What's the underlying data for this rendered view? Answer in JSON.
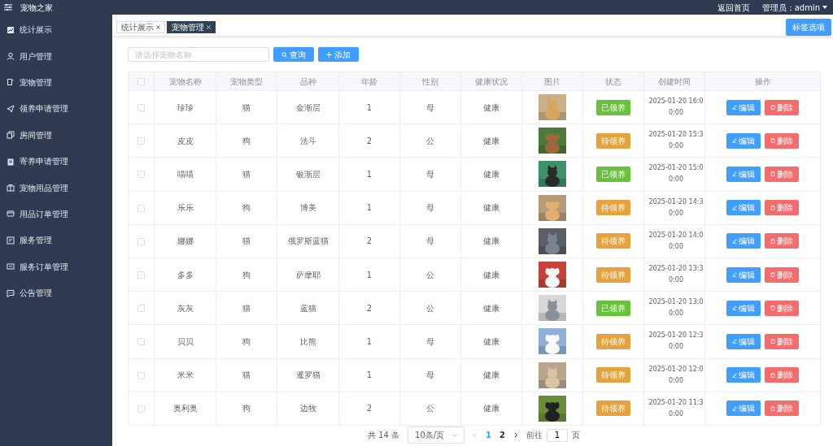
{
  "app": {
    "title": "宠物之家",
    "home_link": "返回首页",
    "user": "管理员：admin"
  },
  "sidebar": {
    "items": [
      {
        "label": "统计展示"
      },
      {
        "label": "用户管理"
      },
      {
        "label": "宠物管理"
      },
      {
        "label": "领养申请管理"
      },
      {
        "label": "房间管理"
      },
      {
        "label": "寄养申请管理"
      },
      {
        "label": "宠物用品管理"
      },
      {
        "label": "用品订单管理"
      },
      {
        "label": "服务管理"
      },
      {
        "label": "服务订单管理"
      },
      {
        "label": "公告管理"
      }
    ]
  },
  "tabs": [
    {
      "label": "统计展示",
      "selected": false
    },
    {
      "label": "宠物管理",
      "selected": true
    }
  ],
  "tab_options": "标签选项",
  "search": {
    "placeholder": "请选择宠物名称",
    "query_button": "查询",
    "add_button": "添加"
  },
  "table": {
    "select_all_checked": false,
    "columns": [
      "宠物名称",
      "宠物类型",
      "品种",
      "年龄",
      "性别",
      "健康状况",
      "图片",
      "状态",
      "创建时间",
      "操作"
    ],
    "rows": [
      {
        "name": "珍珍",
        "type": "猫",
        "breed": "金渐层",
        "age": "1",
        "sex": "母",
        "health": "健康",
        "status": "已领养",
        "adopted": true,
        "created": "2025-01-20 16:00:00",
        "checked": false,
        "edit": "编辑",
        "delete": "删除"
      },
      {
        "name": "皮皮",
        "type": "狗",
        "breed": "法斗",
        "age": "2",
        "sex": "公",
        "health": "健康",
        "status": "待领养",
        "adopted": false,
        "created": "2025-01-20 15:30:00",
        "checked": false,
        "edit": "编辑",
        "delete": "删除"
      },
      {
        "name": "喵喵",
        "type": "猫",
        "breed": "银渐层",
        "age": "1",
        "sex": "母",
        "health": "健康",
        "status": "已领养",
        "adopted": true,
        "created": "2025-01-20 15:00:00",
        "checked": false,
        "edit": "编辑",
        "delete": "删除"
      },
      {
        "name": "乐乐",
        "type": "狗",
        "breed": "博美",
        "age": "1",
        "sex": "母",
        "health": "健康",
        "status": "待领养",
        "adopted": false,
        "created": "2025-01-20 14:30:00",
        "checked": false,
        "edit": "编辑",
        "delete": "删除"
      },
      {
        "name": "娜娜",
        "type": "猫",
        "breed": "俄罗斯蓝猫",
        "age": "2",
        "sex": "母",
        "health": "健康",
        "status": "待领养",
        "adopted": false,
        "created": "2025-01-20 14:00:00",
        "checked": false,
        "edit": "编辑",
        "delete": "删除"
      },
      {
        "name": "多多",
        "type": "狗",
        "breed": "萨摩耶",
        "age": "1",
        "sex": "公",
        "health": "健康",
        "status": "待领养",
        "adopted": false,
        "created": "2025-01-20 13:30:00",
        "checked": false,
        "edit": "编辑",
        "delete": "删除"
      },
      {
        "name": "灰灰",
        "type": "猫",
        "breed": "蓝猫",
        "age": "2",
        "sex": "公",
        "health": "健康",
        "status": "已领养",
        "adopted": true,
        "created": "2025-01-20 13:00:00",
        "checked": false,
        "edit": "编辑",
        "delete": "删除"
      },
      {
        "name": "贝贝",
        "type": "狗",
        "breed": "比熊",
        "age": "1",
        "sex": "母",
        "health": "健康",
        "status": "待领养",
        "adopted": false,
        "created": "2025-01-20 12:30:00",
        "checked": false,
        "edit": "编辑",
        "delete": "删除"
      },
      {
        "name": "米米",
        "type": "猫",
        "breed": "暹罗猫",
        "age": "1",
        "sex": "母",
        "health": "健康",
        "status": "待领养",
        "adopted": false,
        "created": "2025-01-20 12:00:00",
        "checked": false,
        "edit": "编辑",
        "delete": "删除"
      },
      {
        "name": "奥利奥",
        "type": "狗",
        "breed": "边牧",
        "age": "2",
        "sex": "公",
        "health": "健康",
        "status": "待领养",
        "adopted": false,
        "created": "2025-01-20 11:30:00",
        "checked": false,
        "edit": "编辑",
        "delete": "删除"
      }
    ]
  },
  "pagination": {
    "total": "共 14 条",
    "page_size": "10条/页",
    "pages": [
      {
        "label": "1",
        "selected": true
      },
      {
        "label": "2",
        "selected": false
      }
    ],
    "goto_label": "前往",
    "goto_value": "1",
    "page_suffix": "页"
  }
}
